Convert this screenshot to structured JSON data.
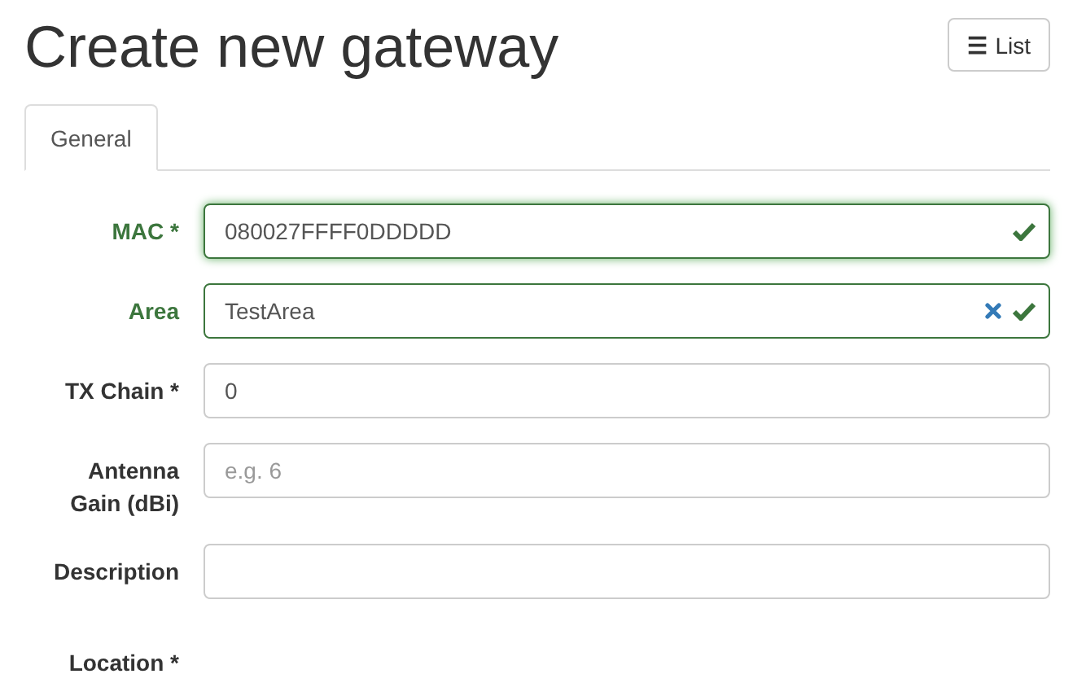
{
  "page": {
    "title": "Create new gateway",
    "list_button": {
      "icon": "☰",
      "label": "List"
    }
  },
  "tabs": [
    {
      "label": "General",
      "selected": true
    }
  ],
  "form": {
    "fields": [
      {
        "kind": "text",
        "label": "MAC *",
        "value": "080027FFFF0DDDDD",
        "valid": true,
        "clearable": false,
        "focused": true
      },
      {
        "kind": "text",
        "label": "Area",
        "value": "TestArea",
        "valid": true,
        "clearable": true,
        "focused": false
      },
      {
        "kind": "text",
        "label": "TX Chain *",
        "value": "0",
        "valid": false,
        "clearable": false,
        "focused": false
      },
      {
        "kind": "text",
        "label": "Antenna Gain (dBi)",
        "placeholder": "e.g. 6",
        "valid": false,
        "clearable": false,
        "focused": false
      },
      {
        "kind": "text",
        "label": "Description",
        "valid": false,
        "clearable": false,
        "focused": false
      },
      {
        "kind": "label-only",
        "label": "Location *"
      }
    ]
  }
}
